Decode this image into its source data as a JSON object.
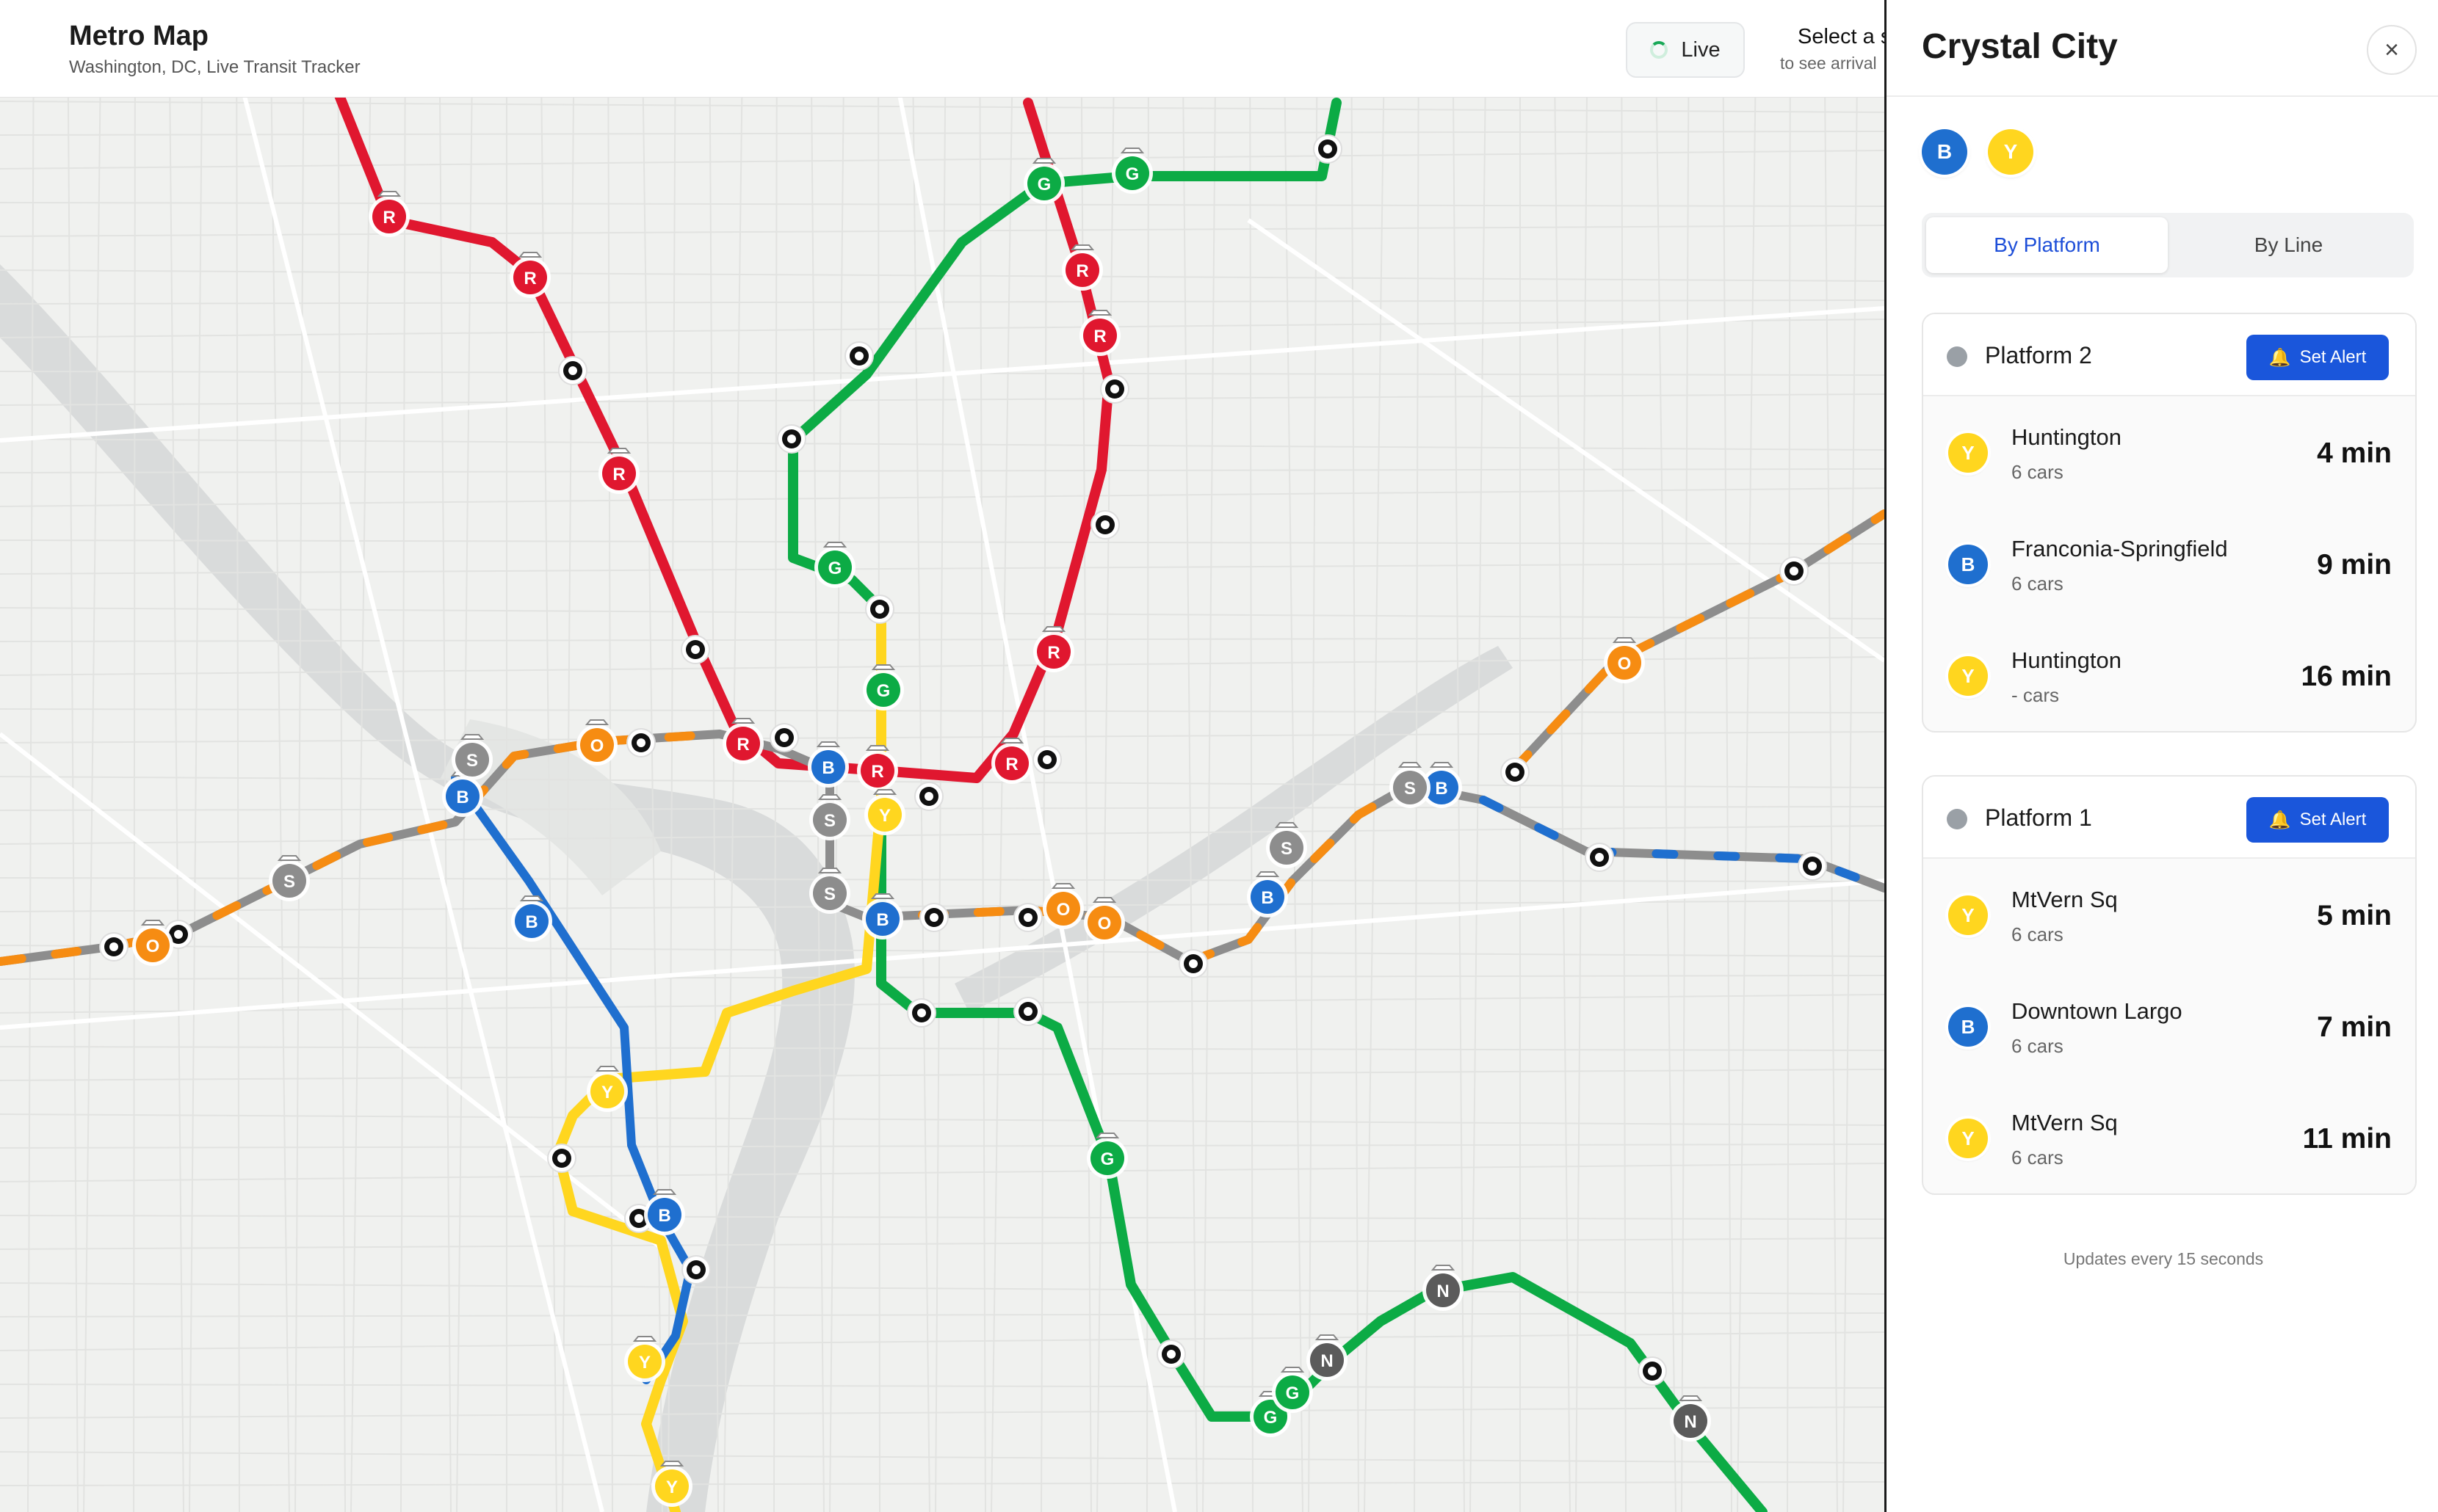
{
  "header": {
    "title": "Metro Map",
    "subtitle": "Washington, DC, Live Transit Tracker",
    "live_label": "Live",
    "select_hint_1": "Select a s",
    "select_hint_2": "to see arrival"
  },
  "colors": {
    "red": "#e0172f",
    "green": "#0cab45",
    "yellow": "#ffd61f",
    "blue": "#1f6fcf",
    "orange": "#f68c12",
    "silver": "#8d8d8d",
    "accent": "#1a56db"
  },
  "panel": {
    "station_name": "Crystal City",
    "close_icon": "×",
    "lines": [
      "B",
      "Y"
    ],
    "tabs": [
      "By Platform",
      "By Line"
    ],
    "active_tab": "By Platform",
    "alert_label": "Set Alert",
    "platforms": [
      {
        "name": "Platform 2",
        "arrivals": [
          {
            "line": "Y",
            "destination": "Huntington",
            "cars": "6 cars",
            "time": "4 min"
          },
          {
            "line": "B",
            "destination": "Franconia-Springfield",
            "cars": "6 cars",
            "time": "9 min"
          },
          {
            "line": "Y",
            "destination": "Huntington",
            "cars": "- cars",
            "time": "16 min"
          }
        ]
      },
      {
        "name": "Platform 1",
        "arrivals": [
          {
            "line": "Y",
            "destination": "MtVern Sq",
            "cars": "6 cars",
            "time": "5 min"
          },
          {
            "line": "B",
            "destination": "Downtown Largo",
            "cars": "6 cars",
            "time": "7 min"
          },
          {
            "line": "Y",
            "destination": "MtVern Sq",
            "cars": "6 cars",
            "time": "11 min"
          }
        ]
      }
    ],
    "footer": "Updates every 15 seconds"
  },
  "map": {
    "train_labels": [
      "R",
      "G",
      "Y",
      "B",
      "O",
      "S",
      "N"
    ]
  }
}
